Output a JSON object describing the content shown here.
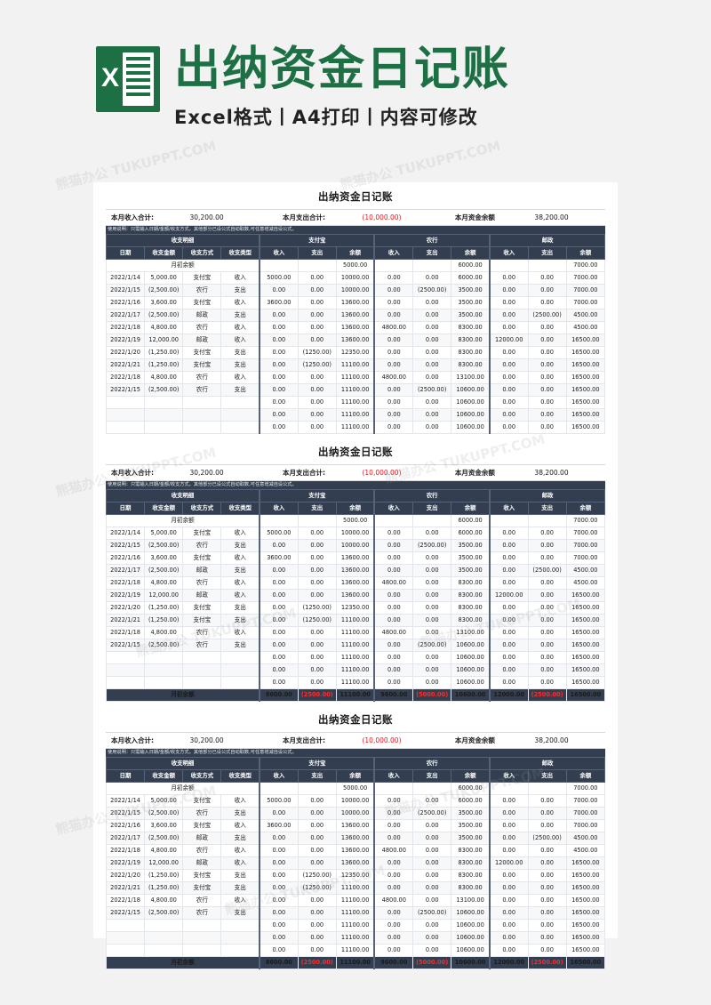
{
  "banner": {
    "logo_letter": "X",
    "logo_name": "excel-logo",
    "title": "出纳资金日记账",
    "subtitle": "Excel格式丨A4打印丨内容可修改",
    "brand_green": "#1d7044"
  },
  "watermarks": [
    "熊猫办公 TUKUPPT.COM",
    "熊猫办公 TUKUPPT.COM",
    "熊猫办公 TUKUPPT.COM",
    "熊猫办公 TUKUPPT.COM",
    "熊猫办公 TUKUPPT.COM",
    "熊猫办公 TUKUPPT.COM",
    "熊猫办公 TUKUPPT.COM",
    "熊猫办公 TUKUPPT.COM",
    "熊猫办公 TUKUPPT.COM"
  ],
  "sheet": {
    "title": "出纳资金日记账",
    "note": "使用说明：只需输入日期/金额/收支方式，其他部分已设公式自动取数,可任意增减自设公式。",
    "summary": {
      "income_label": "本月收入合计:",
      "income_value": "30,200.00",
      "expense_label": "本月支出合计:",
      "expense_value": "(10,000.00)",
      "balance_label": "本月资金余额",
      "balance_value": "38,200.00"
    },
    "groups": [
      {
        "label": "收支明细",
        "span": 4
      },
      {
        "label": "支付宝",
        "span": 3
      },
      {
        "label": "农行",
        "span": 3
      },
      {
        "label": "邮政",
        "span": 3
      }
    ],
    "columns": [
      "日期",
      "收支金额",
      "收支方式",
      "收支类型",
      "收入",
      "支出",
      "余额",
      "收入",
      "支出",
      "余额",
      "收入",
      "支出",
      "余额"
    ],
    "opening_label": "月初余额",
    "opening": {
      "alipay_balance": "5000.00",
      "bank_balance": "6000.00",
      "post_balance": "7000.00"
    },
    "total_label": "月初余额",
    "rows": [
      {
        "date": "2022/1/14",
        "amount": "5,000.00",
        "amount_neg": false,
        "method": "支付宝",
        "type": "收入",
        "a_in": "5000.00",
        "a_out": "0.00",
        "a_bal": "10000.00",
        "a_out_neg": false,
        "b_in": "0.00",
        "b_out": "0.00",
        "b_bal": "6000.00",
        "b_out_neg": false,
        "p_in": "0.00",
        "p_out": "0.00",
        "p_bal": "7000.00",
        "p_out_neg": false
      },
      {
        "date": "2022/1/15",
        "amount": "(2,500.00)",
        "amount_neg": true,
        "method": "农行",
        "type": "支出",
        "a_in": "0.00",
        "a_out": "0.00",
        "a_bal": "10000.00",
        "a_out_neg": false,
        "b_in": "0.00",
        "b_out": "(2500.00)",
        "b_bal": "3500.00",
        "b_out_neg": true,
        "p_in": "0.00",
        "p_out": "0.00",
        "p_bal": "7000.00",
        "p_out_neg": false
      },
      {
        "date": "2022/1/16",
        "amount": "3,600.00",
        "amount_neg": false,
        "method": "支付宝",
        "type": "收入",
        "a_in": "3600.00",
        "a_out": "0.00",
        "a_bal": "13600.00",
        "a_out_neg": false,
        "b_in": "0.00",
        "b_out": "0.00",
        "b_bal": "3500.00",
        "b_out_neg": false,
        "p_in": "0.00",
        "p_out": "0.00",
        "p_bal": "7000.00",
        "p_out_neg": false
      },
      {
        "date": "2022/1/17",
        "amount": "(2,500.00)",
        "amount_neg": true,
        "method": "邮政",
        "type": "支出",
        "a_in": "0.00",
        "a_out": "0.00",
        "a_bal": "13600.00",
        "a_out_neg": false,
        "b_in": "0.00",
        "b_out": "0.00",
        "b_bal": "3500.00",
        "b_out_neg": false,
        "p_in": "0.00",
        "p_out": "(2500.00)",
        "p_bal": "4500.00",
        "p_out_neg": true
      },
      {
        "date": "2022/1/18",
        "amount": "4,800.00",
        "amount_neg": false,
        "method": "农行",
        "type": "收入",
        "a_in": "0.00",
        "a_out": "0.00",
        "a_bal": "13600.00",
        "a_out_neg": false,
        "b_in": "4800.00",
        "b_out": "0.00",
        "b_bal": "8300.00",
        "b_out_neg": false,
        "p_in": "0.00",
        "p_out": "0.00",
        "p_bal": "4500.00",
        "p_out_neg": false
      },
      {
        "date": "2022/1/19",
        "amount": "12,000.00",
        "amount_neg": false,
        "method": "邮政",
        "type": "收入",
        "a_in": "0.00",
        "a_out": "0.00",
        "a_bal": "13600.00",
        "a_out_neg": false,
        "b_in": "0.00",
        "b_out": "0.00",
        "b_bal": "8300.00",
        "b_out_neg": false,
        "p_in": "12000.00",
        "p_out": "0.00",
        "p_bal": "16500.00",
        "p_out_neg": false
      },
      {
        "date": "2022/1/20",
        "amount": "(1,250.00)",
        "amount_neg": true,
        "method": "支付宝",
        "type": "支出",
        "a_in": "0.00",
        "a_out": "(1250.00)",
        "a_bal": "12350.00",
        "a_out_neg": true,
        "b_in": "0.00",
        "b_out": "0.00",
        "b_bal": "8300.00",
        "b_out_neg": false,
        "p_in": "0.00",
        "p_out": "0.00",
        "p_bal": "16500.00",
        "p_out_neg": false
      },
      {
        "date": "2022/1/21",
        "amount": "(1,250.00)",
        "amount_neg": true,
        "method": "支付宝",
        "type": "支出",
        "a_in": "0.00",
        "a_out": "(1250.00)",
        "a_bal": "11100.00",
        "a_out_neg": true,
        "b_in": "0.00",
        "b_out": "0.00",
        "b_bal": "8300.00",
        "b_out_neg": false,
        "p_in": "0.00",
        "p_out": "0.00",
        "p_bal": "16500.00",
        "p_out_neg": false
      },
      {
        "date": "2022/1/18",
        "amount": "4,800.00",
        "amount_neg": false,
        "method": "农行",
        "type": "收入",
        "a_in": "0.00",
        "a_out": "0.00",
        "a_bal": "11100.00",
        "a_out_neg": false,
        "b_in": "4800.00",
        "b_out": "0.00",
        "b_bal": "13100.00",
        "b_out_neg": false,
        "p_in": "0.00",
        "p_out": "0.00",
        "p_bal": "16500.00",
        "p_out_neg": false
      },
      {
        "date": "2022/1/15",
        "amount": "(2,500.00)",
        "amount_neg": true,
        "method": "农行",
        "type": "支出",
        "a_in": "0.00",
        "a_out": "0.00",
        "a_bal": "11100.00",
        "a_out_neg": false,
        "b_in": "0.00",
        "b_out": "(2500.00)",
        "b_bal": "10600.00",
        "b_out_neg": true,
        "p_in": "0.00",
        "p_out": "0.00",
        "p_bal": "16500.00",
        "p_out_neg": false
      },
      {
        "date": "",
        "amount": "",
        "amount_neg": false,
        "method": "",
        "type": "",
        "a_in": "0.00",
        "a_out": "0.00",
        "a_bal": "11100.00",
        "a_out_neg": false,
        "b_in": "0.00",
        "b_out": "0.00",
        "b_bal": "10600.00",
        "b_out_neg": false,
        "p_in": "0.00",
        "p_out": "0.00",
        "p_bal": "16500.00",
        "p_out_neg": false
      },
      {
        "date": "",
        "amount": "",
        "amount_neg": false,
        "method": "",
        "type": "",
        "a_in": "0.00",
        "a_out": "0.00",
        "a_bal": "11100.00",
        "a_out_neg": false,
        "b_in": "0.00",
        "b_out": "0.00",
        "b_bal": "10600.00",
        "b_out_neg": false,
        "p_in": "0.00",
        "p_out": "0.00",
        "p_bal": "16500.00",
        "p_out_neg": false
      },
      {
        "date": "",
        "amount": "",
        "amount_neg": false,
        "method": "",
        "type": "",
        "a_in": "0.00",
        "a_out": "0.00",
        "a_bal": "11100.00",
        "a_out_neg": false,
        "b_in": "0.00",
        "b_out": "0.00",
        "b_bal": "10600.00",
        "b_out_neg": false,
        "p_in": "0.00",
        "p_out": "0.00",
        "p_bal": "16500.00",
        "p_out_neg": false
      }
    ],
    "totals": {
      "a_in": "8600.00",
      "a_out": "(2500.00)",
      "a_bal": "11100.00",
      "b_in": "9600.00",
      "b_out": "(5000.00)",
      "b_bal": "10600.00",
      "p_in": "12000.00",
      "p_out": "(2500.00)",
      "p_bal": "16500.00"
    }
  },
  "colors": {
    "header_navy": "#333f50",
    "negative_red": "#e8161a",
    "page_bg": "#f2f2f2",
    "paper": "#ffffff"
  }
}
